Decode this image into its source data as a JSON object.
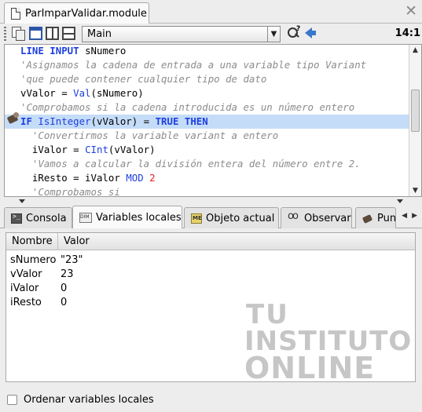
{
  "file_tab": {
    "label": "ParImparValidar.module",
    "close_icon": "close-icon"
  },
  "toolbar": {
    "procedure_select": "Main",
    "cursor_position": "14:1",
    "icons": [
      "copy-icon",
      "single-view-icon",
      "split-view-icon",
      "horizontal-split-icon",
      "find-icon",
      "back-arrow-icon"
    ]
  },
  "code": {
    "lines": [
      [
        [
          "kw",
          "LINE INPUT"
        ],
        [
          "id",
          " sNumero"
        ]
      ],
      [
        [
          "cm",
          "'Asignamos la cadena de entrada a una variable tipo Variant"
        ]
      ],
      [
        [
          "cm",
          "'que puede contener cualquier tipo de dato"
        ]
      ],
      [
        [
          "id",
          "vValor = "
        ],
        [
          "fn",
          "Val"
        ],
        [
          "id",
          "(sNumero)"
        ]
      ],
      [
        [
          "cm",
          "'Comprobamos si la cadena introducida es un número entero"
        ]
      ],
      [
        [
          "kw",
          "IF"
        ],
        [
          "id",
          " "
        ],
        [
          "fn",
          "IsInteger"
        ],
        [
          "id",
          "(vValor) = "
        ],
        [
          "kw",
          "TRUE THEN"
        ]
      ],
      [
        [
          "cm",
          "  'Convertirmos la variable variant a entero"
        ]
      ],
      [
        [
          "id",
          "  iValor = "
        ],
        [
          "fn",
          "CInt"
        ],
        [
          "id",
          "(vValor)"
        ]
      ],
      [
        [
          "cm",
          "  'Vamos a calcular la división entera del número entre 2."
        ]
      ],
      [
        [
          "id",
          "  iResto = iValor "
        ],
        [
          "fn",
          "MOD"
        ],
        [
          "id",
          " "
        ],
        [
          "nm",
          "2"
        ]
      ],
      [
        [
          "cm",
          "  'Comprobamos si"
        ]
      ]
    ],
    "current_line_index": 5,
    "colors": {
      "keyword": "#1d3fe0",
      "comment": "#8c8c8c",
      "number": "#e2201c",
      "current_line": "#c4dcf7"
    }
  },
  "bottom_tabs": [
    {
      "label": "Consola",
      "icon": "console-icon",
      "active": false
    },
    {
      "label": "Variables locales",
      "icon": "dim-icon",
      "active": true
    },
    {
      "label": "Objeto actual",
      "icon": "me-icon",
      "active": false
    },
    {
      "label": "Observar",
      "icon": "glasses-icon",
      "active": false
    },
    {
      "label": "Pun",
      "icon": "breakpoint-icon",
      "active": false
    }
  ],
  "variables": {
    "columns": [
      "Nombre",
      "Valor"
    ],
    "rows": [
      {
        "name": "sNumero",
        "value": "\"23\""
      },
      {
        "name": "vValor",
        "value": "23"
      },
      {
        "name": "iValor",
        "value": "0"
      },
      {
        "name": "iResto",
        "value": "0"
      }
    ],
    "order_checkbox": {
      "label": "Ordenar variables locales",
      "checked": false
    }
  },
  "watermark": {
    "line1": "TU",
    "line2": "INSTITUTO",
    "line3": "ONLINE"
  }
}
